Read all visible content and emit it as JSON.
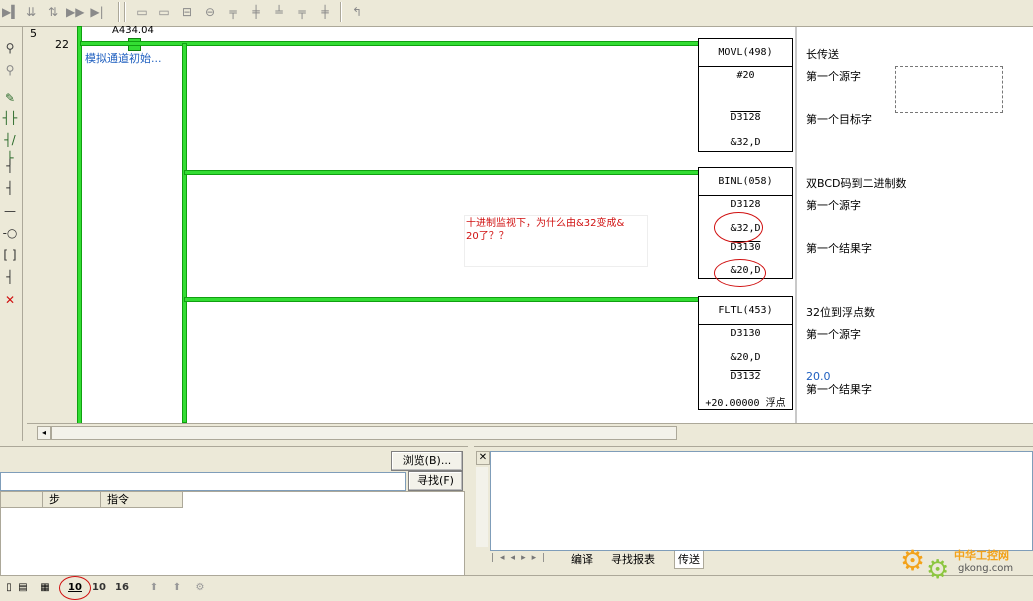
{
  "toolbar": {
    "icons": [
      "first-icon",
      "step-icon",
      "step2-icon",
      "forward-icon",
      "last-icon",
      "grid-icon",
      "grid2-icon",
      "contact-icon",
      "coil-icon",
      "branch-icon",
      "branch2-icon",
      "branch3-icon",
      "branch4-icon",
      "return-icon"
    ]
  },
  "ladder": {
    "rung_number": "5",
    "step_number": "22",
    "contact_address": "A434.04",
    "contact_comment": "模拟通道初始...",
    "annotation": "十进制监视下，为什么由&32变成&20了？？",
    "instructions": [
      {
        "mnemonic": "MOVL(498)",
        "operands": [
          "#20",
          "D3128",
          "&32,D"
        ],
        "comment_title": "长传送",
        "comments": [
          "第一个源字",
          "第一个目标字"
        ]
      },
      {
        "mnemonic": "BINL(058)",
        "operands": [
          "D3128",
          "&32,D",
          "D3130",
          "&20,D"
        ],
        "comment_title": "双BCD码到二进制数",
        "comments": [
          "第一个源字",
          "第一个结果字"
        ]
      },
      {
        "mnemonic": "FLTL(453)",
        "operands": [
          "D3130",
          "&20,D",
          "D3132",
          "+20.00000 浮点"
        ],
        "comment_title": "32位到浮点数",
        "comments": [
          "第一个源字",
          "第一个结果字"
        ],
        "value_readout": "20.0"
      }
    ]
  },
  "search_panel": {
    "browse_button": "浏览(B)...",
    "find_button": "寻找(F)",
    "columns": [
      "",
      "步",
      "指令"
    ]
  },
  "output_panel": {
    "tabs": [
      "编译",
      "寻找报表",
      "传送"
    ]
  },
  "bottombar": {
    "display_modes": [
      "10",
      "10",
      "16"
    ]
  },
  "watermark": {
    "text": "中华工控网",
    "url": "gkong.com"
  },
  "colors": {
    "rung_green": "#33dd33",
    "annotation_red": "#d01010",
    "comment_blue": "#2060c0"
  }
}
